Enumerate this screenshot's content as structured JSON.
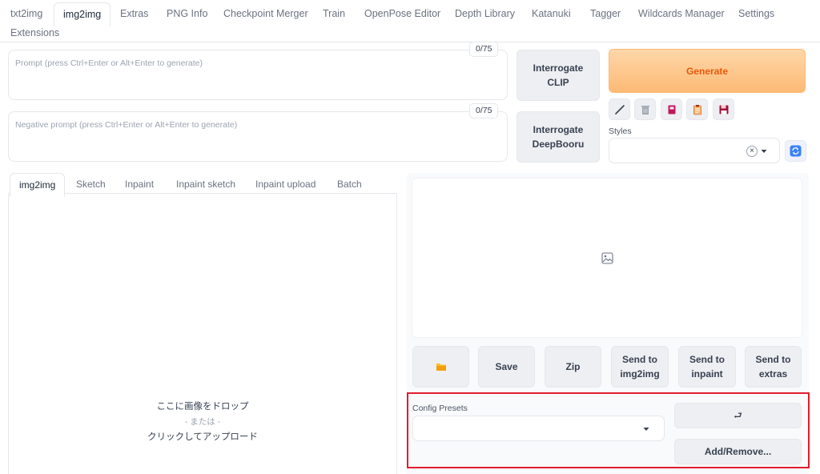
{
  "tabs": [
    "txt2img",
    "img2img",
    "Extras",
    "PNG Info",
    "Checkpoint Merger",
    "Train",
    "OpenPose Editor",
    "Depth Library",
    "Katanuki",
    "Tagger",
    "Wildcards Manager",
    "Settings",
    "Extensions"
  ],
  "active_tab": "img2img",
  "prompt": {
    "placeholder": "Prompt (press Ctrl+Enter or Alt+Enter to generate)",
    "counter": "0/75"
  },
  "negative_prompt": {
    "placeholder": "Negative prompt (press Ctrl+Enter or Alt+Enter to generate)",
    "counter": "0/75"
  },
  "buttons": {
    "interrogate_clip": [
      "Interrogate",
      "CLIP"
    ],
    "interrogate_deepbooru": [
      "Interrogate",
      "DeepBooru"
    ],
    "generate": "Generate"
  },
  "tools": [
    "brush-icon",
    "trash-icon",
    "bookmark-icon",
    "clipboard-icon",
    "save-icon"
  ],
  "styles": {
    "label": "Styles",
    "clear": "×"
  },
  "subtabs": [
    "img2img",
    "Sketch",
    "Inpaint",
    "Inpaint sketch",
    "Inpaint upload",
    "Batch"
  ],
  "upload": {
    "line1": "ここに画像をドロップ",
    "line2": "- または -",
    "line3": "クリックしてアップロード"
  },
  "output_buttons": {
    "save": "Save",
    "zip": "Zip",
    "send_img2img": [
      "Send to",
      "img2img"
    ],
    "send_inpaint": [
      "Send to",
      "inpaint"
    ],
    "send_extras": [
      "Send to",
      "extras"
    ]
  },
  "config_presets": {
    "label": "Config Presets",
    "apply": "⮐",
    "add_remove": "Add/Remove..."
  },
  "colors": {
    "generate": "#ea580c",
    "highlight": "#e11d2e",
    "style_refresh": "#3b82f6"
  }
}
